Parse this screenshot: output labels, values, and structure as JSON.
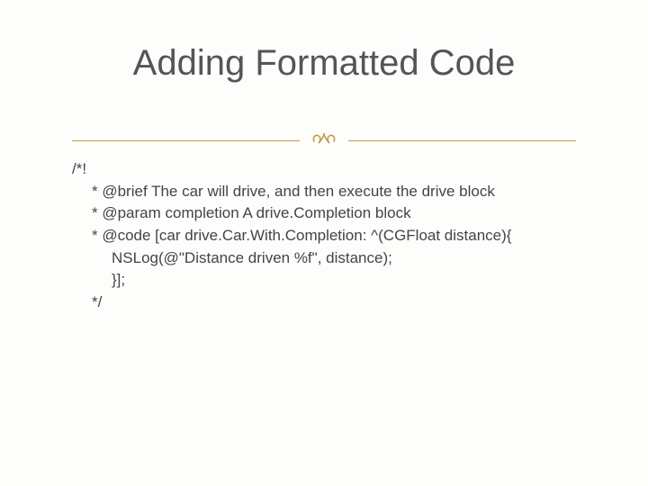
{
  "title": "Adding Formatted Code",
  "flourish": "་",
  "code": {
    "l1": "/*!",
    "l2": "* @brief The car will drive, and then execute the drive block",
    "l3": "* @param completion A drive.Completion block",
    "l4": "* @code [car drive.Car.With.Completion: ^(CGFloat distance){",
    "l5": "NSLog(@\"Distance driven %f\", distance);",
    "l6": "}];",
    "l7": "*/"
  }
}
